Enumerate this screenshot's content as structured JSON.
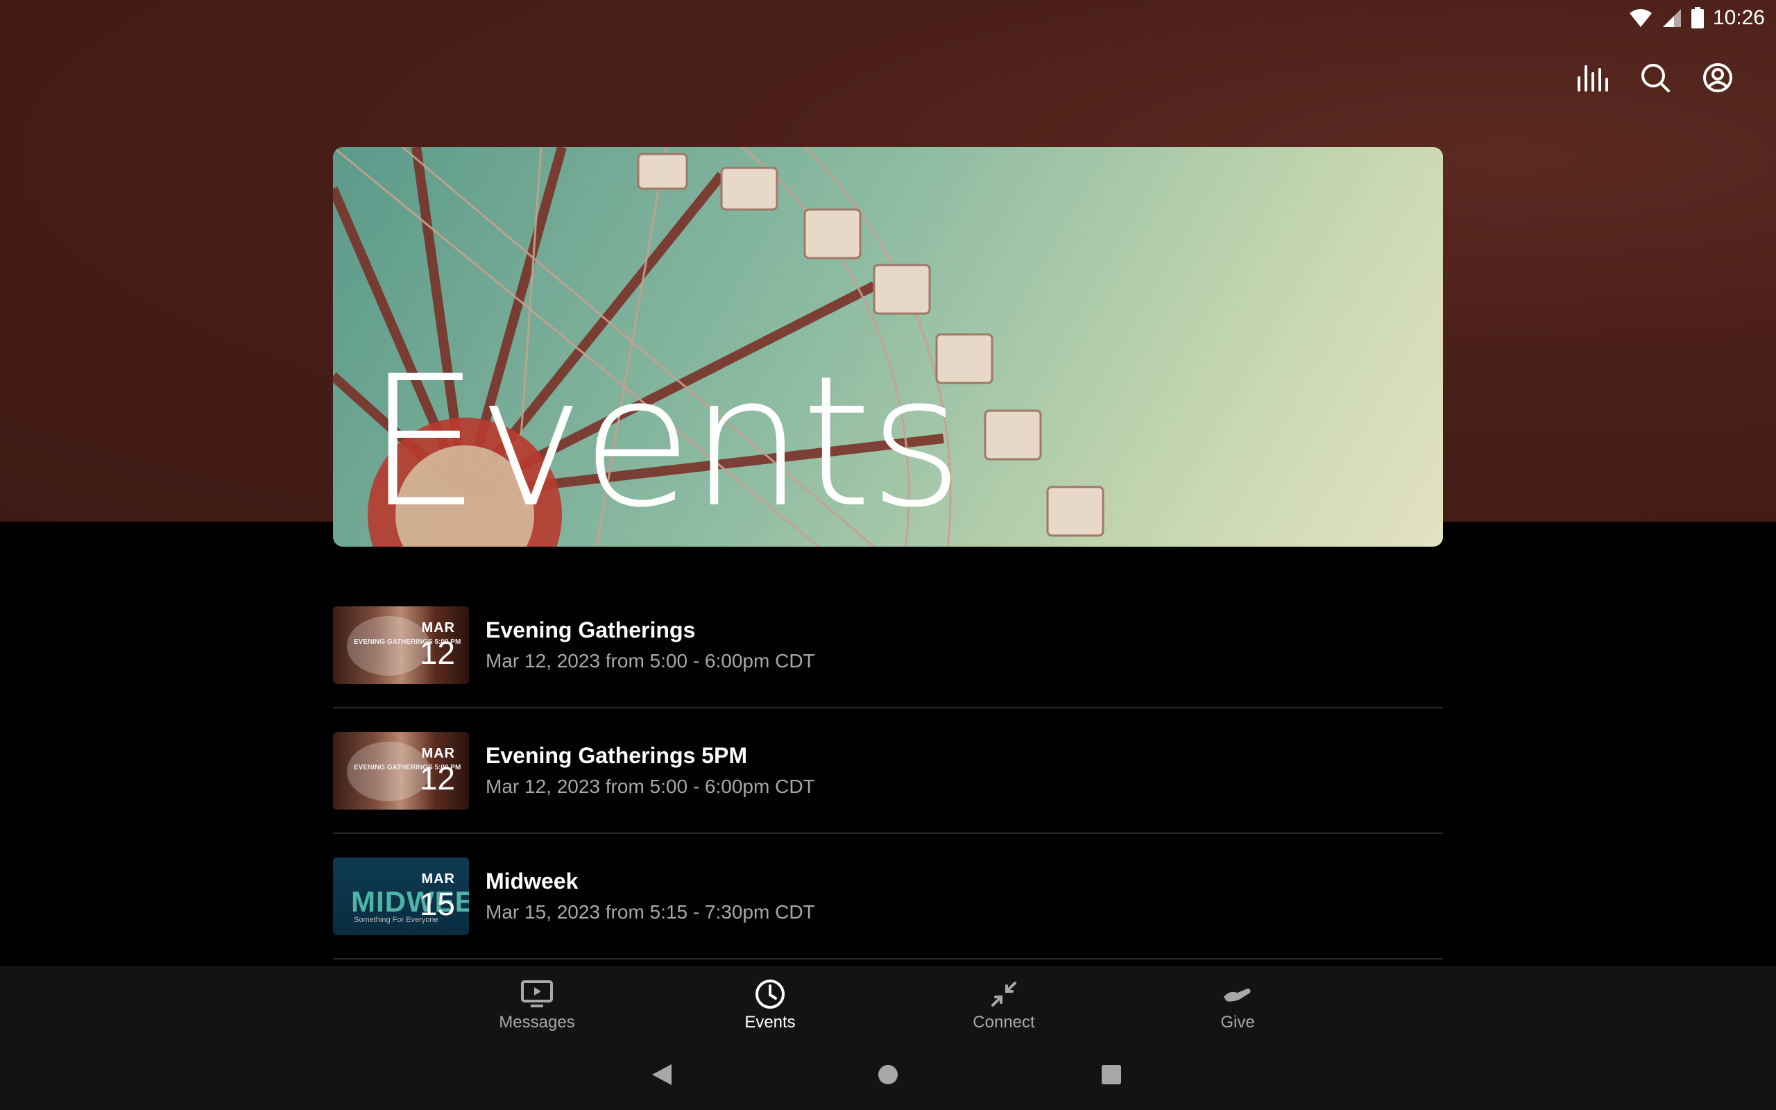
{
  "status_bar": {
    "time": "10:26"
  },
  "hero": {
    "title": "Events"
  },
  "events": [
    {
      "title": "Evening Gatherings",
      "date": "Mar 12, 2023 from 5:00 - 6:00pm CDT",
      "thumb_month": "MAR",
      "thumb_day": "12",
      "thumb_text": "EVENING GATHERINGS 5:00 PM"
    },
    {
      "title": "Evening Gatherings 5PM",
      "date": "Mar 12, 2023 from 5:00 - 6:00pm CDT",
      "thumb_month": "MAR",
      "thumb_day": "12",
      "thumb_text": "EVENING GATHERINGS 5:00 PM"
    },
    {
      "title": "Midweek",
      "date": "Mar 15, 2023 from 5:15 - 7:30pm CDT",
      "thumb_month": "MAR",
      "thumb_day": "15",
      "thumb_text": "MIDWEEK",
      "thumb_subtext": "Something For Everyone"
    }
  ],
  "bottom_nav": [
    {
      "label": "Messages",
      "icon": "tv-play-icon",
      "active": false
    },
    {
      "label": "Events",
      "icon": "clock-icon",
      "active": true
    },
    {
      "label": "Connect",
      "icon": "arrows-inward-icon",
      "active": false
    },
    {
      "label": "Give",
      "icon": "hand-icon",
      "active": false
    }
  ],
  "colors": {
    "header_bg": "#4a1f18",
    "nav_bg": "#121314",
    "muted_text": "#a8a8a8"
  }
}
